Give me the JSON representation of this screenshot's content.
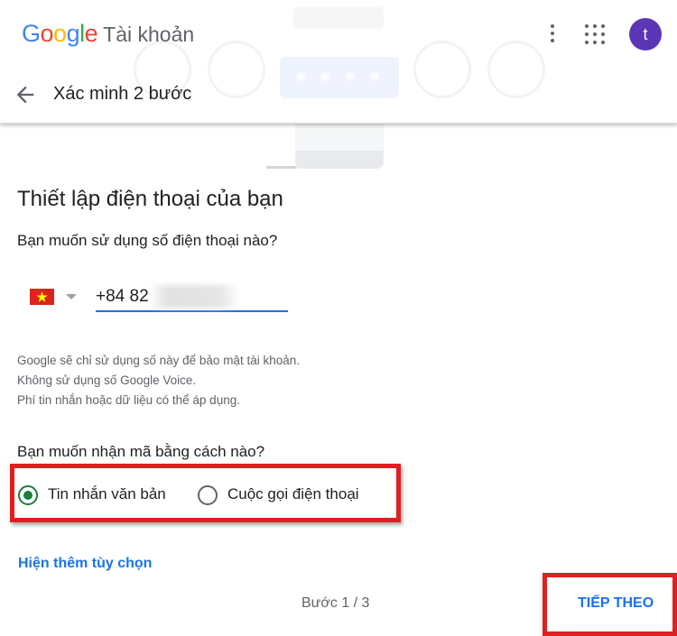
{
  "header": {
    "logo_text": "Google",
    "title": "Tài khoản",
    "avatar_initial": "t",
    "subtitle": "Xác minh 2 bước"
  },
  "main": {
    "heading": "Thiết lập điện thoại của bạn",
    "phone_question": "Bạn muốn sử dụng số điện thoại nào?",
    "country_flag": "vietnam-flag",
    "phone_value": "+84 82",
    "notes": [
      "Google sẽ chỉ sử dụng số này để bảo mật tài khoản.",
      "Không sử dụng số Google Voice.",
      "Phí tin nhắn hoặc dữ liệu có thể áp dụng."
    ],
    "method_question": "Bạn muốn nhận mã bằng cách nào?",
    "options": [
      {
        "label": "Tin nhắn văn bản",
        "selected": true
      },
      {
        "label": "Cuộc gọi điện thoại",
        "selected": false
      }
    ],
    "more_options": "Hiện thêm tùy chọn",
    "step": "Bước 1 / 3",
    "next_label": "TIẾP THEO"
  },
  "colors": {
    "accent": "#1a73e8",
    "radio_selected": "#188038",
    "highlight_box": "#e02020",
    "avatar": "#5b37b6"
  }
}
